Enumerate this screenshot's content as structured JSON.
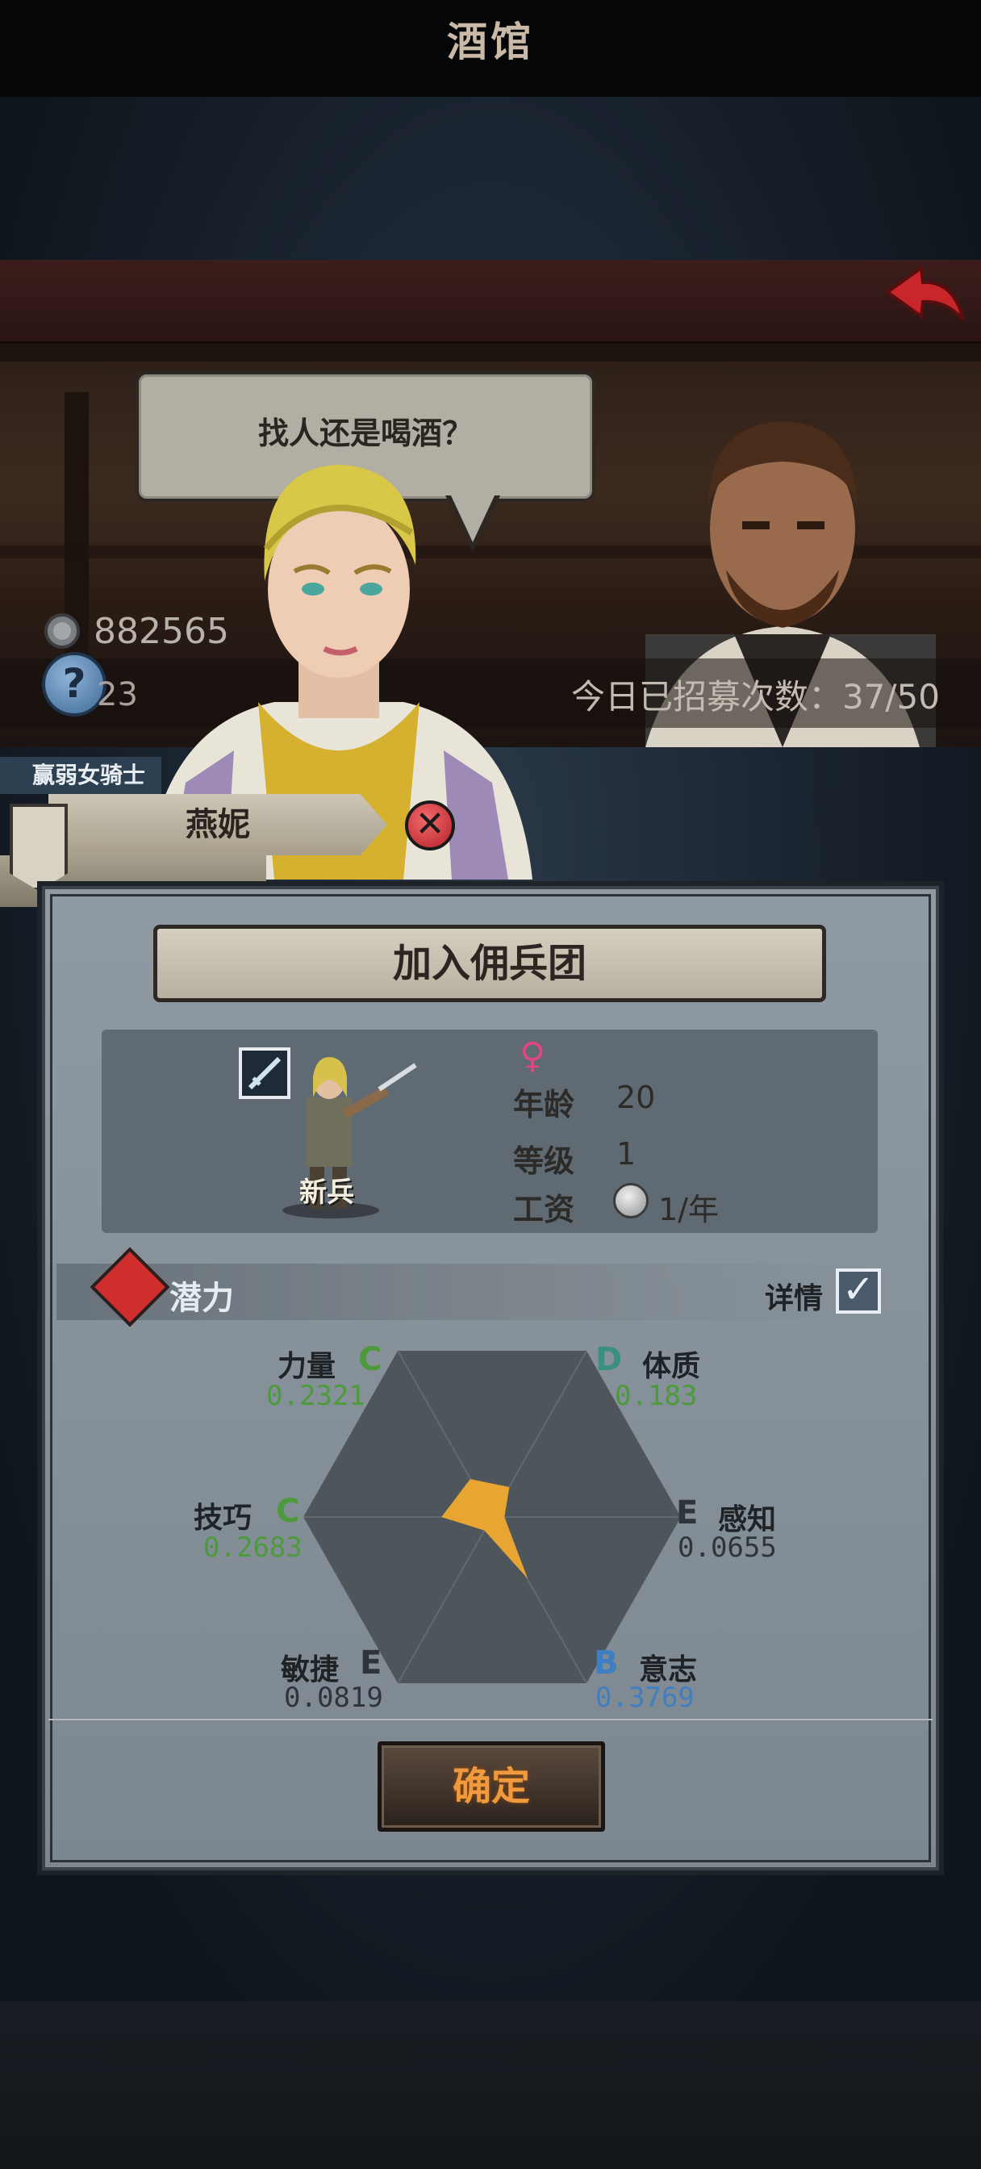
{
  "tavern": {
    "title": "酒馆",
    "speech": "找人还是喝酒？",
    "silver": "882565",
    "help_count": "23",
    "recruit_count": "今日已招募次数：37/50"
  },
  "hero": {
    "title": "赢弱女骑士",
    "name": "燕妮"
  },
  "dialog": {
    "title": "加入佣兵团",
    "class_label": "新兵",
    "gender_icon": "female-icon",
    "age_label": "年龄",
    "age_value": "20",
    "level_label": "等级",
    "level_value": "1",
    "wage_label": "工资",
    "wage_value": "1/年",
    "potential_label": "潜力",
    "details_label": "详情",
    "details_checked": true,
    "confirm_label": "确定"
  },
  "chart_data": {
    "type": "radar",
    "axes": [
      "力量",
      "体质",
      "感知",
      "意志",
      "敏捷",
      "技巧"
    ],
    "grades": [
      "C",
      "D",
      "E",
      "B",
      "E",
      "C"
    ],
    "values": [
      0.2321,
      0.183,
      0.0655,
      0.3769,
      0.0819,
      0.2683
    ],
    "display_values": [
      "0.2321",
      "0.183",
      "0.0655",
      "0.3769",
      "0.0819",
      "0.2683"
    ],
    "max": 1.0,
    "fill_color": "#e8a531"
  },
  "colors": {
    "grade_C": "#4d9a3c",
    "grade_D": "#3a8f7f",
    "grade_E": "#2f3438",
    "grade_B": "#3f7ec0"
  }
}
